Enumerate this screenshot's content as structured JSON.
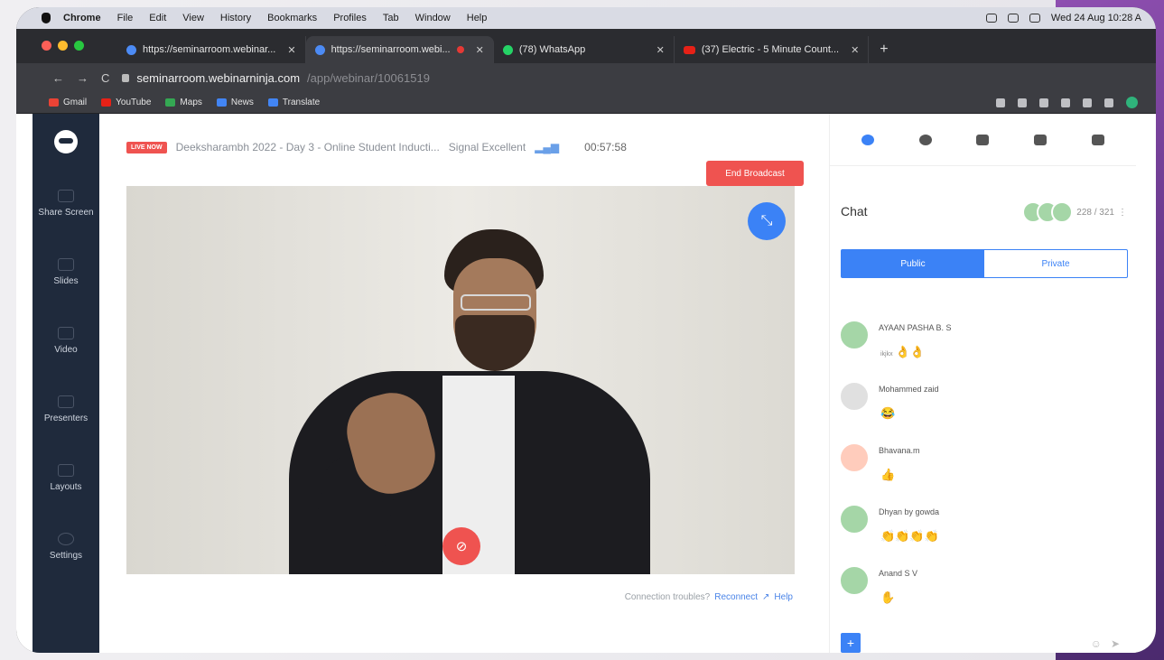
{
  "macbar": {
    "app": "Chrome",
    "menus": [
      "File",
      "Edit",
      "View",
      "History",
      "Bookmarks",
      "Profiles",
      "Tab",
      "Window",
      "Help"
    ],
    "clock": "Wed 24 Aug  10:28 A"
  },
  "tabs": [
    {
      "title": "https://seminarroom.webinar...",
      "icon": "webinarninja-favicon"
    },
    {
      "title": "https://seminarroom.webi...",
      "icon": "webinarninja-favicon",
      "recording": true
    },
    {
      "title": "(78) WhatsApp",
      "icon": "whatsapp-icon"
    },
    {
      "title": "(37) Electric - 5 Minute Count...",
      "icon": "youtube-icon"
    }
  ],
  "address": {
    "host": "seminarroom.webinarninja.com",
    "path": "/app/webinar/10061519"
  },
  "bookmarks": [
    "Gmail",
    "YouTube",
    "Maps",
    "News",
    "Translate"
  ],
  "nav": {
    "items": [
      "Share Screen",
      "Slides",
      "Video",
      "Presenters",
      "Layouts",
      "Settings"
    ]
  },
  "header": {
    "live_badge": "LIVE NOW",
    "title": "Deeksharambh 2022 - Day 3 - Online Student Inducti...",
    "signal": "Signal Excellent",
    "timer": "00:57:58",
    "end_button": "End Broadcast"
  },
  "video": {
    "connection_text": "Connection troubles?",
    "reconnect_label": "Reconnect",
    "help_label": "Help"
  },
  "chat": {
    "title": "Chat",
    "viewer_count": "228 / 321",
    "tab_public": "Public",
    "tab_private": "Private",
    "messages": [
      {
        "name": "AYAAN PASHA B. S",
        "text": "👌👌",
        "prefix": "ikjkx",
        "avatar_color": "#a5d6a7"
      },
      {
        "name": "Mohammed zaid",
        "text": "😂",
        "prefix": "",
        "avatar_color": "#e0e0e0"
      },
      {
        "name": "Bhavana.m",
        "text": "👍",
        "prefix": "",
        "avatar_color": "#ffccbc"
      },
      {
        "name": "Dhyan by gowda",
        "text": "👏👏👏👏",
        "prefix": "",
        "avatar_color": "#a5d6a7"
      },
      {
        "name": "Anand S V",
        "text": "✋",
        "prefix": "",
        "avatar_color": "#a5d6a7"
      }
    ]
  },
  "colors": {
    "accent": "#3b82f6",
    "live_red": "#ef5350",
    "nav_bg": "#1f2a3c"
  }
}
